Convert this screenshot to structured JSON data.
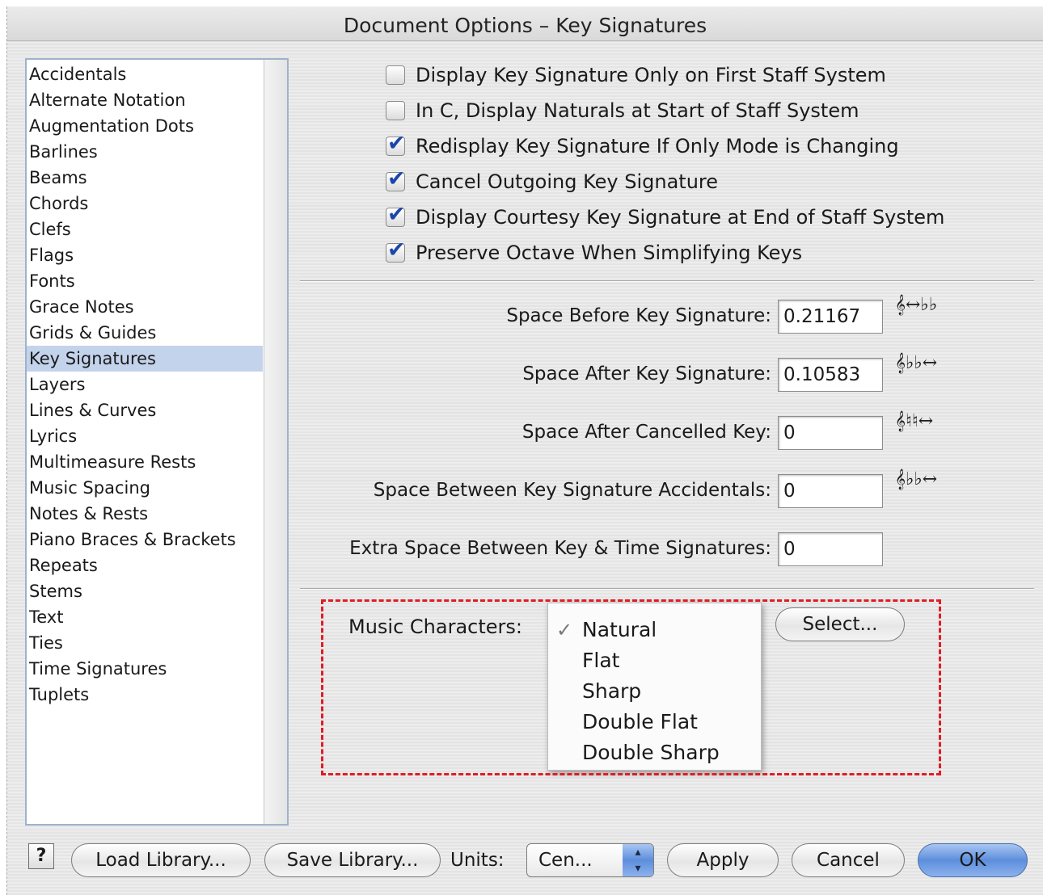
{
  "window": {
    "title": "Document Options – Key Signatures"
  },
  "sidebar": {
    "selected": "Key Signatures",
    "items": [
      "Accidentals",
      "Alternate Notation",
      "Augmentation Dots",
      "Barlines",
      "Beams",
      "Chords",
      "Clefs",
      "Flags",
      "Fonts",
      "Grace Notes",
      "Grids & Guides",
      "Key Signatures",
      "Layers",
      "Lines & Curves",
      "Lyrics",
      "Multimeasure Rests",
      "Music Spacing",
      "Notes & Rests",
      "Piano Braces & Brackets",
      "Repeats",
      "Stems",
      "Text",
      "Ties",
      "Time Signatures",
      "Tuplets"
    ]
  },
  "options": [
    {
      "label": "Display Key Signature Only on First Staff System",
      "checked": false
    },
    {
      "label": "In C, Display Naturals at Start of Staff System",
      "checked": false
    },
    {
      "label": "Redisplay Key Signature If Only Mode is Changing",
      "checked": true
    },
    {
      "label": "Cancel Outgoing Key Signature",
      "checked": true
    },
    {
      "label": "Display Courtesy Key Signature at End of Staff System",
      "checked": true
    },
    {
      "label": "Preserve Octave When Simplifying Keys",
      "checked": true
    }
  ],
  "fields": [
    {
      "label": "Space Before Key Signature:",
      "value": "0.21167",
      "glyph": "𝄞↔♭♭"
    },
    {
      "label": "Space After Key Signature:",
      "value": "0.10583",
      "glyph": "𝄞♭♭↔"
    },
    {
      "label": "Space After Cancelled Key:",
      "value": "0",
      "glyph": "𝄞♮♮↔"
    },
    {
      "label": "Space Between Key Signature Accidentals:",
      "value": "0",
      "glyph": "𝄞♭♭↔"
    },
    {
      "label": "Extra Space Between Key & Time Signatures:",
      "value": "0",
      "glyph": ""
    }
  ],
  "music_characters": {
    "label": "Music Characters:",
    "selected": "Natural",
    "options": [
      "Natural",
      "Flat",
      "Sharp",
      "Double Flat",
      "Double Sharp"
    ],
    "select_button": "Select..."
  },
  "footer": {
    "help": "?",
    "load_library": "Load Library...",
    "save_library": "Save Library...",
    "units_label": "Units:",
    "units_value": "Cen...",
    "apply": "Apply",
    "cancel": "Cancel",
    "ok": "OK"
  },
  "colors": {
    "selection": "#c4d3ec",
    "default_button": "#5d8edc",
    "highlight_border": "#e01c24",
    "checkmark": "#1c47a8"
  }
}
